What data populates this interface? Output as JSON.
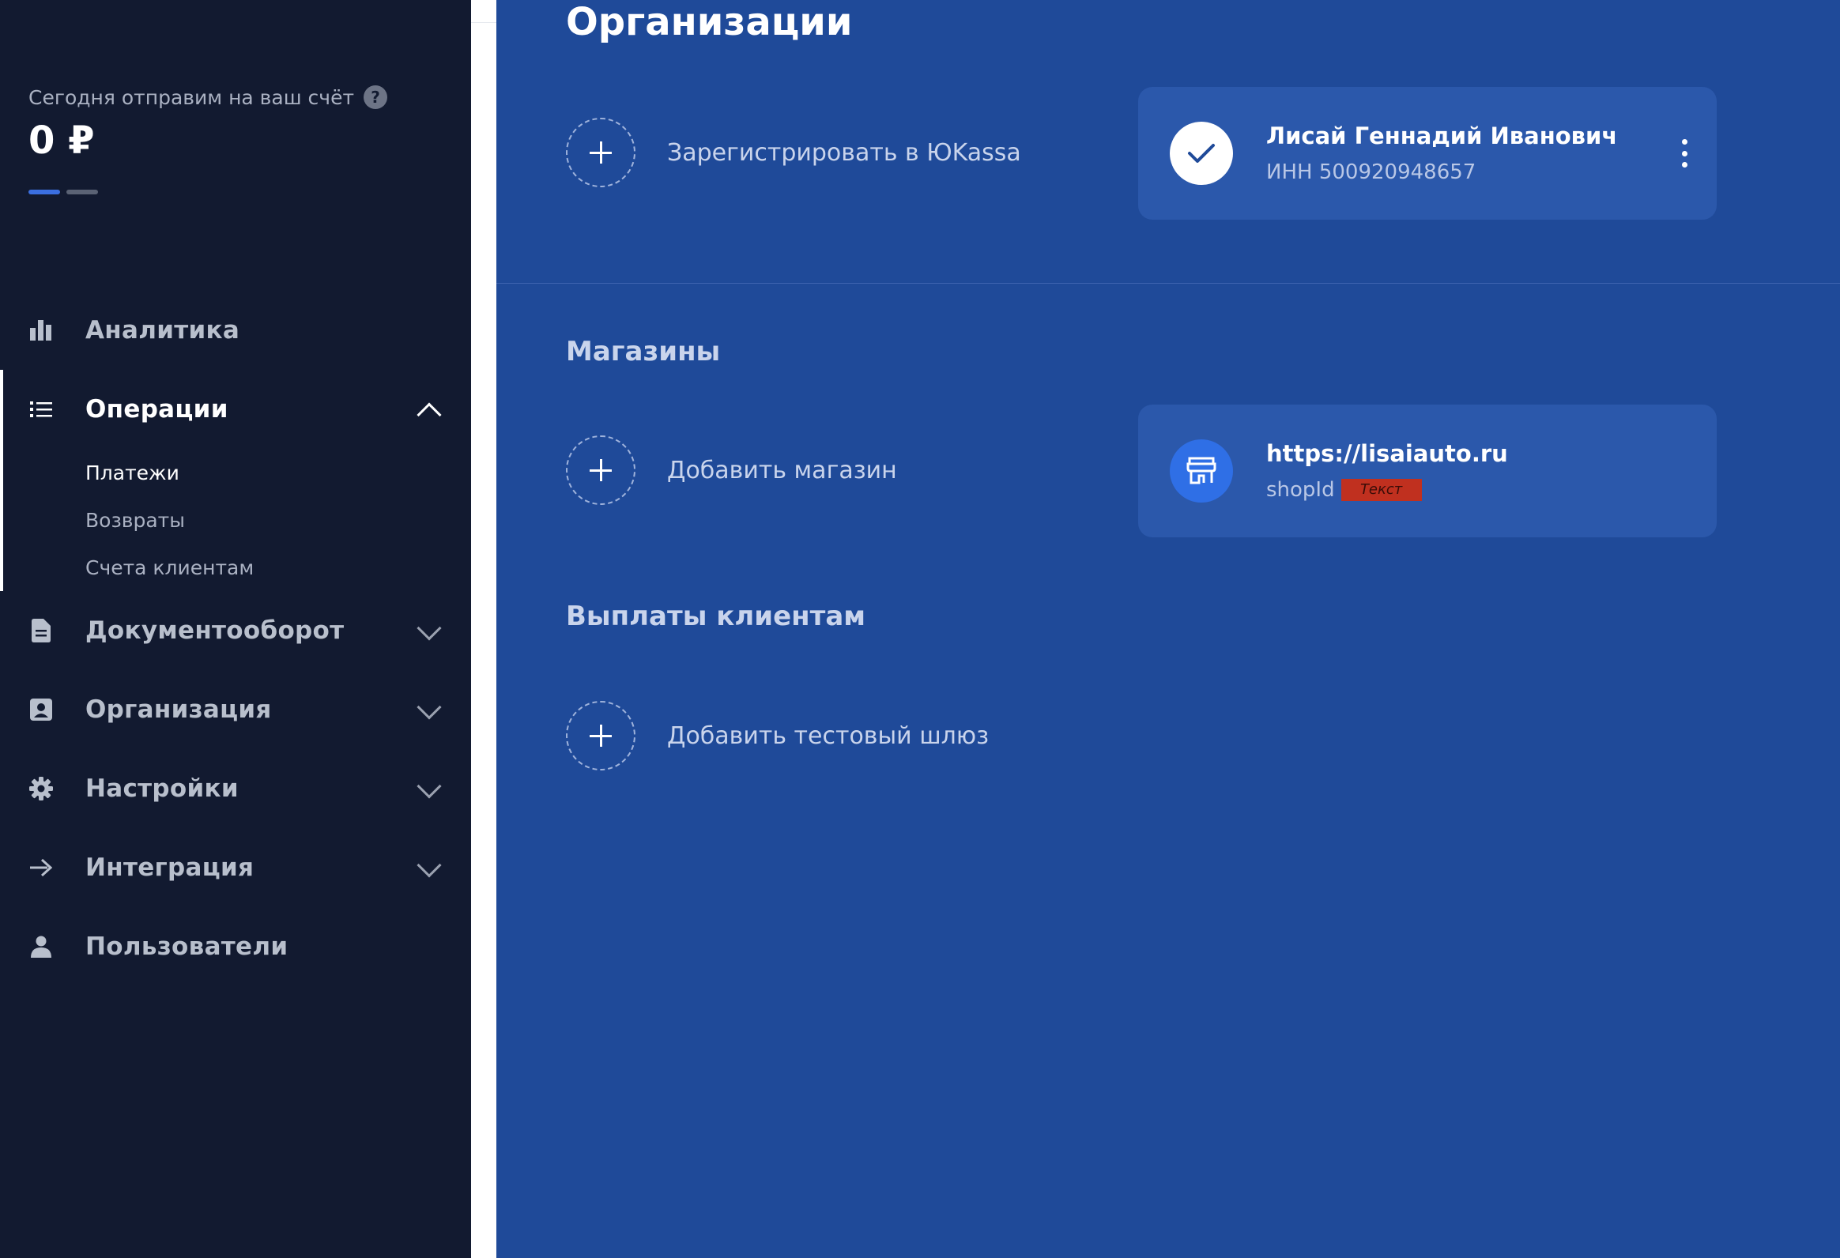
{
  "sidebar": {
    "balance": {
      "caption": "Сегодня отправим на ваш счёт",
      "help_glyph": "?",
      "value": "0 ₽"
    },
    "nav": [
      {
        "label": "Аналитика",
        "icon": "bar-chart-icon"
      },
      {
        "label": "Операции",
        "icon": "list-icon",
        "expanded": true,
        "children": [
          "Платежи",
          "Возвраты",
          "Счета клиентам"
        ]
      },
      {
        "label": "Документооборот",
        "icon": "document-icon"
      },
      {
        "label": "Организация",
        "icon": "id-card-icon"
      },
      {
        "label": "Настройки",
        "icon": "gear-icon"
      },
      {
        "label": "Интеграция",
        "icon": "arrow-right-icon"
      },
      {
        "label": "Пользователи",
        "icon": "user-icon"
      }
    ]
  },
  "main": {
    "title": "Организации",
    "register_label": "Зарегистрировать в ЮKassa",
    "org_card": {
      "name": "Лисай Геннадий Иванович",
      "inn": "ИНН 500920948657"
    },
    "shops_title": "Магазины",
    "add_shop_label": "Добавить магазин",
    "shop_card": {
      "url": "https://lisaiauto.ru",
      "shop_id_label": "shopId",
      "redacted_text": "Текст"
    },
    "payouts_title": "Выплаты клиентам",
    "add_gateway_label": "Добавить тестовый шлюз"
  },
  "colors": {
    "sidebar_bg": "#121a30",
    "main_bg": "#1f4a99",
    "card_bg": "#2b58ab",
    "accent": "#3b6fe0"
  }
}
